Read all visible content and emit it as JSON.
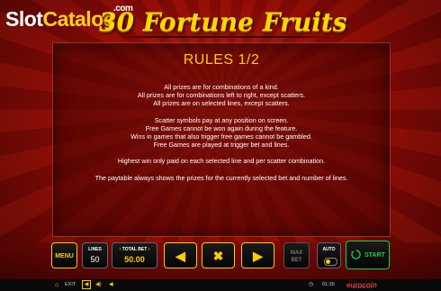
{
  "watermark": {
    "part1": "Slot",
    "part2": "Catalog",
    "suffix": ".com"
  },
  "game": {
    "logo": "30 Fortune Fruits"
  },
  "rules": {
    "title": "RULES 1/2",
    "paragraphs": [
      [
        "All prizes are for combinations of a kind.",
        "All prizes are for combinations left to right, except scatters.",
        "All prizes are on selected lines, except scatters."
      ],
      [
        "Scatter symbols pay at any position on screen.",
        "Free Games cannot be won again during the feature.",
        "Wins in games that also trigger free games cannot be gambled.",
        "Free Games are played at trigger bet and lines."
      ],
      [
        "Highest win only paid on each selected line and per scatter combination."
      ],
      [
        "The paytable always shows the prizes for the currently selected bet and number of lines."
      ]
    ]
  },
  "controls": {
    "menu_label": "MENU",
    "lines_label": "LINES",
    "lines_value": "50",
    "total_bet_label": "TOTAL BET",
    "total_bet_value": "50.00",
    "prev_symbol": "◀",
    "close_symbol": "✖",
    "next_symbol": "▶",
    "max_bet_line1": "MAX",
    "max_bet_line2": "BET",
    "auto_label": "AUTO",
    "start_label": "START"
  },
  "footer": {
    "home_icon": "home-icon",
    "exit_label": "EXIT",
    "clock_icon": "clock-icon",
    "time": "01:35",
    "brand": "eurocoin",
    "brand_sub": "INTERACTIVE"
  },
  "colors": {
    "accent": "#ffcc00",
    "start": "#1fcc4a",
    "brand": "#e83a2e",
    "background": "#8a0a05"
  }
}
